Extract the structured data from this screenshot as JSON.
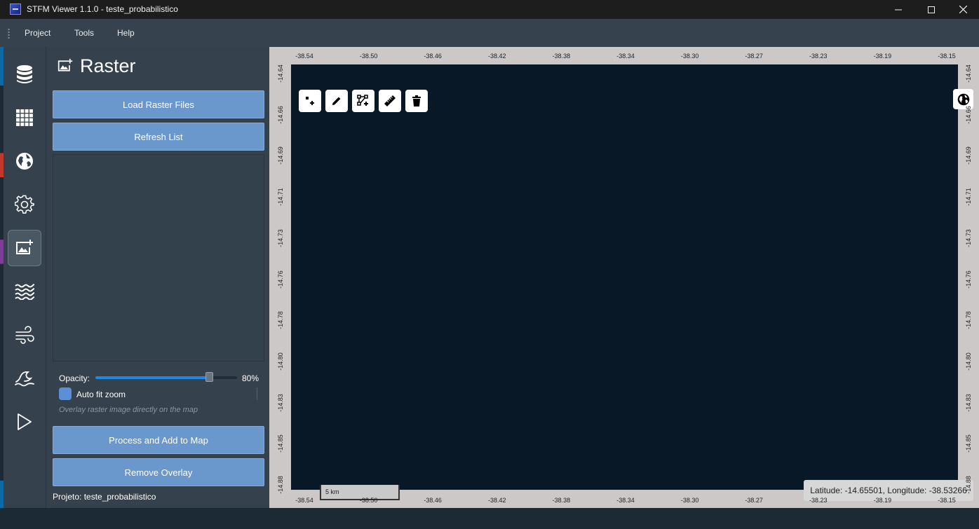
{
  "window": {
    "title": "STFM Viewer 1.1.0 - teste_probabilistico"
  },
  "menu": [
    "Project",
    "Tools",
    "Help"
  ],
  "nav": [
    "database-icon",
    "grid-icon",
    "globe-icon",
    "settings-gear-icon",
    "add-image-icon",
    "waves-icon",
    "wind-icon",
    "tsunami-wave-icon",
    "play-icon"
  ],
  "panel": {
    "title": "Raster",
    "load_button": "Load Raster Files",
    "refresh_button": "Refresh List",
    "opacity_label": "Opacity:",
    "opacity_value": "80%",
    "opacity_fraction": 0.8,
    "auto_fit_label": "Auto fit zoom",
    "auto_fit_checked": true,
    "hint": "Overlay raster image directly on the map",
    "process_button": "Process and Add to Map",
    "remove_button": "Remove Overlay",
    "project_label": "Projeto: teste_probabilistico"
  },
  "map": {
    "lon_ticks": [
      "-38.54",
      "-38.50",
      "-38.46",
      "-38.42",
      "-38.38",
      "-38.34",
      "-38.30",
      "-38.27",
      "-38.23",
      "-38.19",
      "-38.15"
    ],
    "lat_ticks": [
      "-14.64",
      "-14.66",
      "-14.69",
      "-14.71",
      "-14.73",
      "-14.76",
      "-14.78",
      "-14.80",
      "-14.83",
      "-14.85",
      "-14.88"
    ],
    "tools": [
      "add-marker-icon",
      "pencil-icon",
      "polyline-add-icon",
      "ruler-icon",
      "trash-icon"
    ],
    "scale_label": "5 km",
    "coordinates": "Latitude: -14.65501, Longitude: -38.53266"
  },
  "colors": {
    "accent": "#6a98cd",
    "map_background": "#091826",
    "panel": "#35424d",
    "slider": "#1e88e5"
  }
}
